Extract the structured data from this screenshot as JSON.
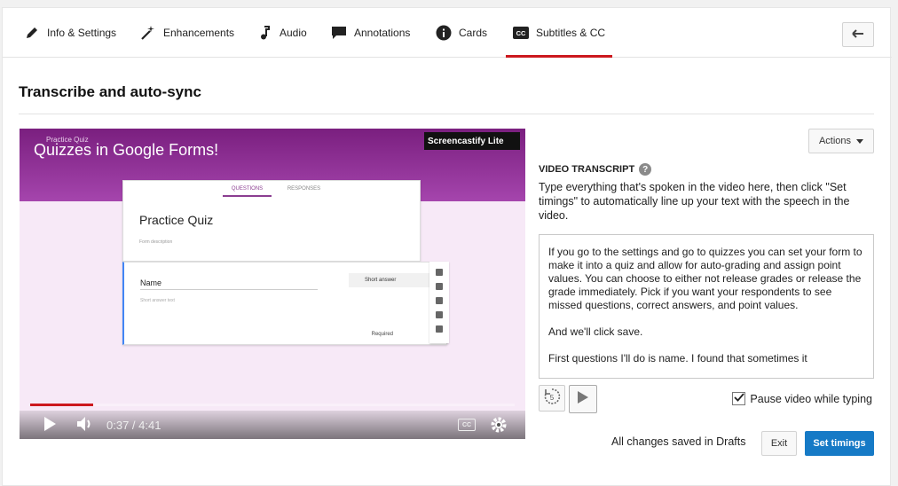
{
  "tabs": [
    {
      "label": "Info & Settings",
      "icon": "pencil-icon"
    },
    {
      "label": "Enhancements",
      "icon": "magic-wand-icon"
    },
    {
      "label": "Audio",
      "icon": "music-note-icon"
    },
    {
      "label": "Annotations",
      "icon": "speech-bubble-icon"
    },
    {
      "label": "Cards",
      "icon": "info-circle-icon"
    },
    {
      "label": "Subtitles & CC",
      "icon": "cc-icon",
      "active": true
    }
  ],
  "section_title": "Transcribe and auto-sync",
  "video": {
    "title": "Quizzes in Google Forms!",
    "small_top": "Practice Quiz",
    "badge": "Screencastify Lite",
    "form": {
      "tab_questions": "QUESTIONS",
      "tab_responses": "RESPONSES",
      "title": "Practice Quiz",
      "description": "Form description",
      "question_name": "Name",
      "question_sub": "Short answer text",
      "question_type": "Short answer",
      "required_label": "Required"
    },
    "time": "0:37 / 4:41",
    "progress_fraction": 0.13,
    "cc_label": "CC"
  },
  "actions_label": "Actions",
  "transcript": {
    "label": "VIDEO TRANSCRIPT",
    "description": "Type everything that's spoken in the video here, then click \"Set timings\" to automatically line up your text with the speech in the video.",
    "text": "If you go to the settings and go to quizzes you can set your form to make it into a quiz and allow for auto-grading and assign point values. You can choose to either not release grades or release the grade immediately. Pick if you want your respondents to see missed questions, correct answers, and point values.\n\nAnd we'll click save.\n\nFirst questions I'll do is name. I found that sometimes it"
  },
  "rewind_seconds": "5",
  "pause_label": "Pause video while typing",
  "pause_checked": true,
  "saved_status": "All changes saved in Drafts",
  "exit_label": "Exit",
  "set_timings_label": "Set timings",
  "colors": {
    "accent_red": "#cc181e",
    "primary_blue": "#167ac6"
  }
}
